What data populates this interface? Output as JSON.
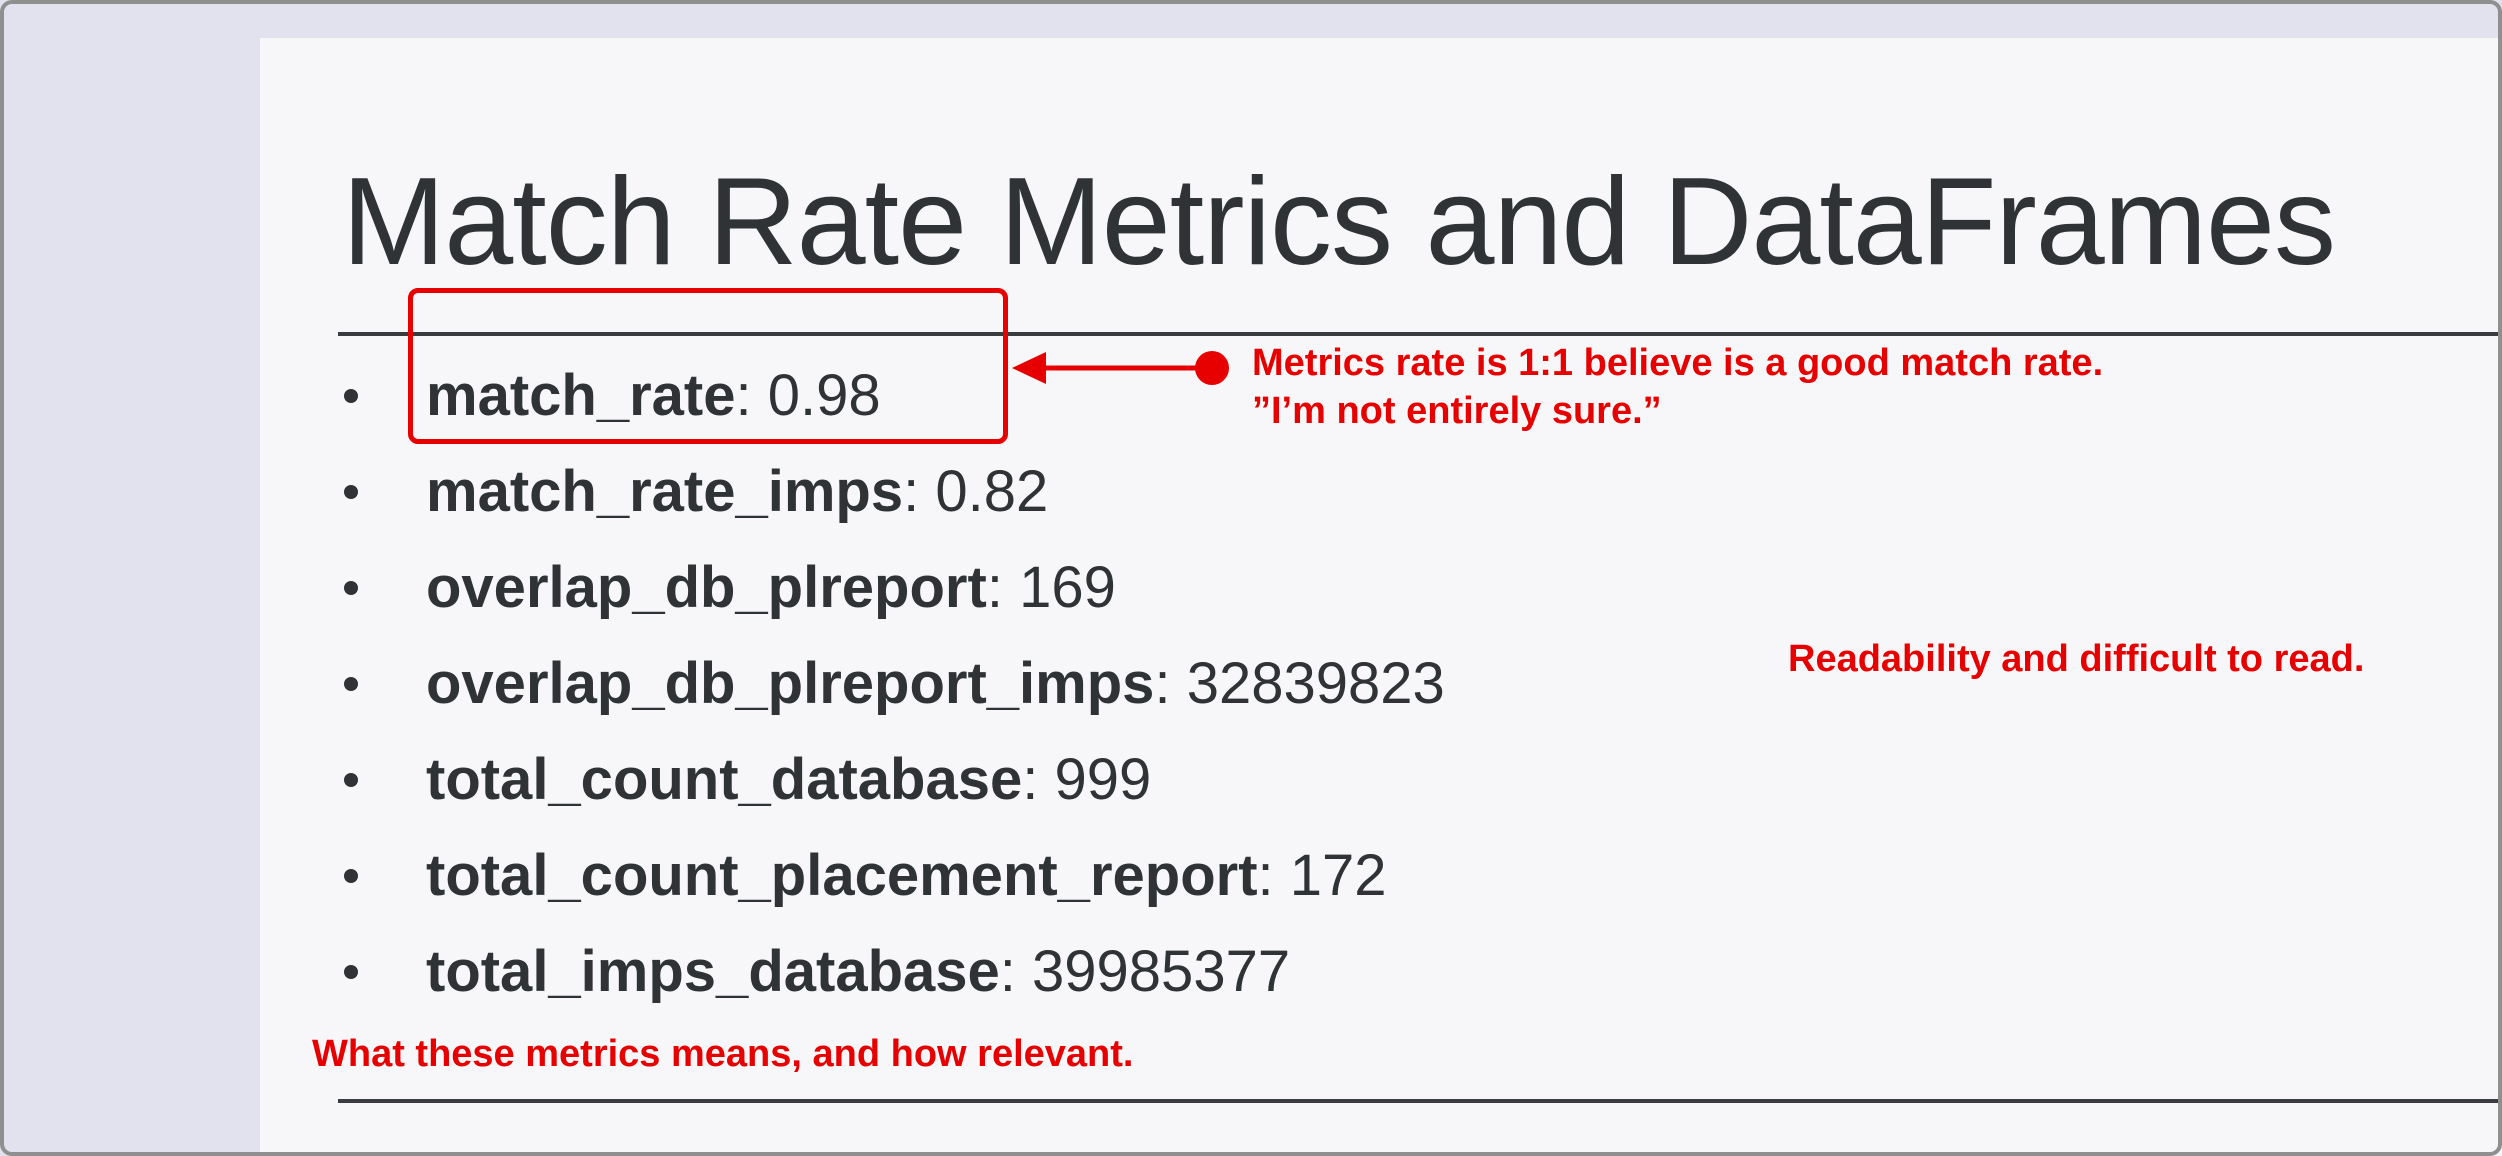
{
  "page": {
    "title": "Match Rate Metrics and DataFrames"
  },
  "metrics": [
    {
      "key": "match_rate",
      "separator": ":",
      "value": "0.98"
    },
    {
      "key": "match_rate_imps",
      "separator": ":",
      "value": "0.82"
    },
    {
      "key": "overlap_db_plreport",
      "separator": ":",
      "value": "169"
    },
    {
      "key": "overlap_db_plreport_imps",
      "separator": ":",
      "value": "32839823"
    },
    {
      "key": "total_count_database",
      "separator": ":",
      "value": "999"
    },
    {
      "key": "total_count_placement_report",
      "separator": ":",
      "value": "172"
    },
    {
      "key": "total_imps_database",
      "separator": ":",
      "value": "39985377"
    }
  ],
  "annotations": {
    "match_rate_note_line1": "Metrics rate is 1:1 believe is a good match rate.",
    "match_rate_note_line2": "”I’m not entirely sure.”",
    "readability_note": "Readability and difficult to read.",
    "relevance_note": "What these metrics means, and how relevant."
  },
  "colors": {
    "annotation": "#e60000",
    "text": "#2f3336",
    "content_background": "#f7f7f9",
    "outer_background": "#e2e2ee"
  }
}
